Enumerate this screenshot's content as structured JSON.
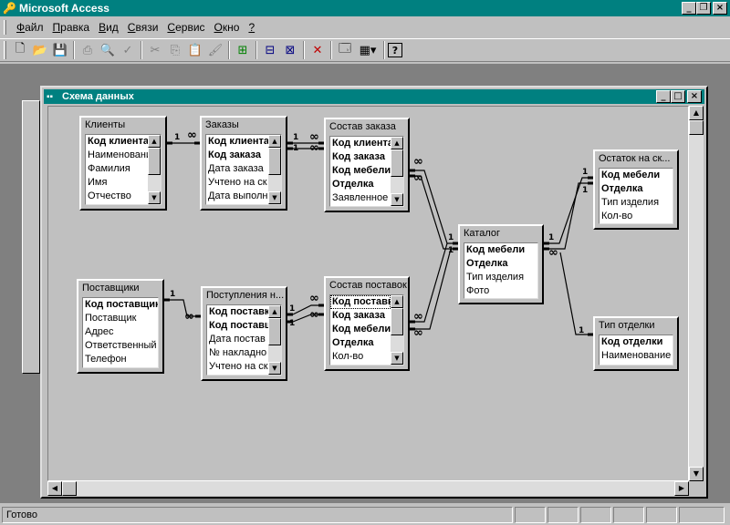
{
  "app": {
    "title": "Microsoft Access"
  },
  "menu": [
    {
      "label": "Файл",
      "u": "Ф",
      "rest": "айл"
    },
    {
      "label": "Правка",
      "u": "П",
      "rest": "равка"
    },
    {
      "label": "Вид",
      "u": "В",
      "rest": "ид"
    },
    {
      "label": "Связи",
      "u": "С",
      "rest": "вязи"
    },
    {
      "label": "Сервис",
      "u": "С",
      "rest": "ервис"
    },
    {
      "label": "Окно",
      "u": "О",
      "rest": "кно"
    },
    {
      "label": "?",
      "u": "?",
      "rest": ""
    }
  ],
  "toolbar_icons": [
    "new-icon",
    "open-icon",
    "save-icon",
    "print-icon",
    "print-preview-icon",
    "spell-check-icon",
    "cut-icon",
    "copy-icon",
    "paste-icon",
    "format-painter-icon",
    "show-table-icon",
    "show-direct-icon",
    "show-all-icon",
    "delete-icon",
    "database-window-icon",
    "new-object-icon",
    "help-icon"
  ],
  "schema": {
    "title": "Схема данных",
    "tables": [
      {
        "id": "clients",
        "title": "Клиенты",
        "fields": [
          {
            "n": "Код клиента",
            "pk": true
          },
          {
            "n": "Наименовани"
          },
          {
            "n": "Фамилия"
          },
          {
            "n": "Имя"
          },
          {
            "n": "Отчество"
          }
        ]
      },
      {
        "id": "orders",
        "title": "Заказы",
        "fields": [
          {
            "n": "Код клиента",
            "pk": true
          },
          {
            "n": "Код заказа",
            "pk": true
          },
          {
            "n": "Дата заказа"
          },
          {
            "n": "Учтено на ск"
          },
          {
            "n": "Дата выполн"
          }
        ]
      },
      {
        "id": "order_items",
        "title": "Состав заказа",
        "fields": [
          {
            "n": "Код клиента",
            "pk": true
          },
          {
            "n": "Код заказа",
            "pk": true
          },
          {
            "n": "Код мебели",
            "pk": true
          },
          {
            "n": "Отделка",
            "pk": true
          },
          {
            "n": "Заявленное к"
          }
        ]
      },
      {
        "id": "stock",
        "title": "Остаток на ск...",
        "fields": [
          {
            "n": "Код мебели",
            "pk": true
          },
          {
            "n": "Отделка",
            "pk": true
          },
          {
            "n": "Тип изделия"
          },
          {
            "n": "Кол-во"
          }
        ]
      },
      {
        "id": "catalog",
        "title": "Каталог",
        "fields": [
          {
            "n": "Код мебели",
            "pk": true
          },
          {
            "n": "Отделка",
            "pk": true
          },
          {
            "n": "Тип изделия"
          },
          {
            "n": "Фото"
          }
        ]
      },
      {
        "id": "suppliers",
        "title": "Поставщики",
        "fields": [
          {
            "n": "Код поставщика",
            "pk": true
          },
          {
            "n": "Поставщик"
          },
          {
            "n": "Адрес"
          },
          {
            "n": "Ответственный"
          },
          {
            "n": "Телефон"
          }
        ]
      },
      {
        "id": "receipts",
        "title": "Поступления н...",
        "fields": [
          {
            "n": "Код поставки",
            "pk": true
          },
          {
            "n": "Код поставщ",
            "pk": true
          },
          {
            "n": "Дата постав"
          },
          {
            "n": "№ накладно"
          },
          {
            "n": "Учтено на ск"
          }
        ]
      },
      {
        "id": "supply_items",
        "title": "Состав поставок",
        "fields": [
          {
            "n": "Код поставки",
            "pk": true,
            "sel": true
          },
          {
            "n": "Код заказа",
            "pk": true
          },
          {
            "n": "Код мебели",
            "pk": true
          },
          {
            "n": "Отделка",
            "pk": true
          },
          {
            "n": "Кол-во"
          }
        ]
      },
      {
        "id": "departments",
        "title": "Тип отделки",
        "fields": [
          {
            "n": "Код отделки",
            "pk": true
          },
          {
            "n": "Наименование о"
          }
        ]
      }
    ],
    "one_label": "1",
    "many_label": "∞"
  },
  "status": {
    "text": "Готово"
  }
}
